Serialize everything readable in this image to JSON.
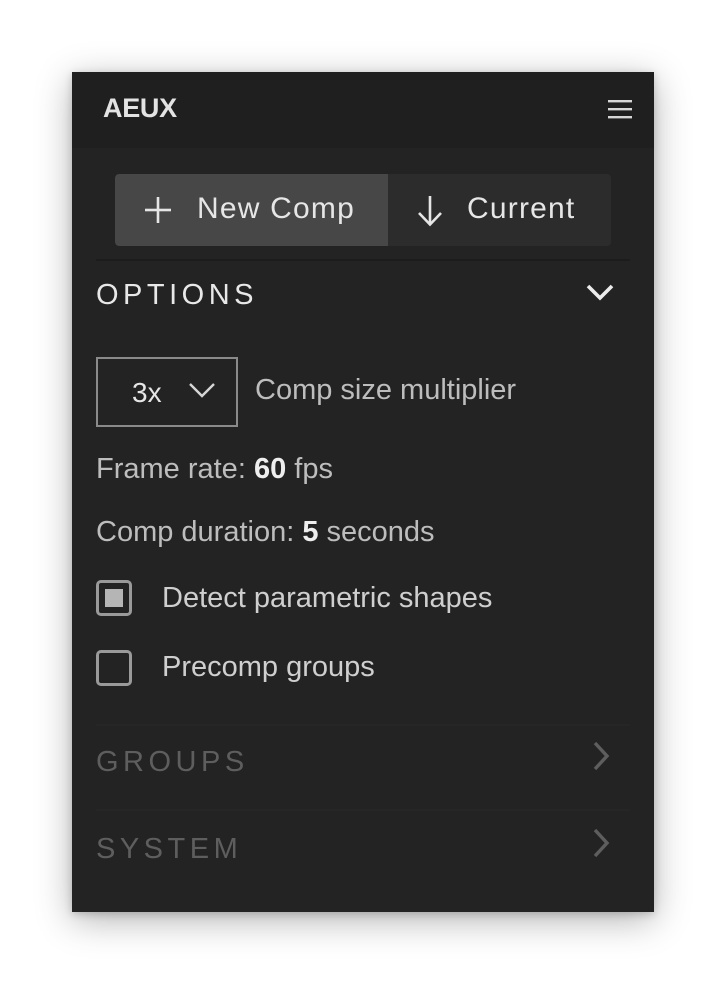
{
  "app": {
    "title": "AEUX"
  },
  "actions": {
    "new_comp_label": "New Comp",
    "current_label": "Current"
  },
  "options": {
    "title": "OPTIONS",
    "multiplier_value": "3x",
    "multiplier_label": "Comp size multiplier",
    "frame_rate_prefix": "Frame rate:",
    "frame_rate_value": "60",
    "frame_rate_unit": "fps",
    "duration_prefix": "Comp duration:",
    "duration_value": "5",
    "duration_unit": "seconds",
    "detect_parametric_label": "Detect parametric shapes",
    "detect_parametric_checked": true,
    "precomp_groups_label": "Precomp groups",
    "precomp_groups_checked": false
  },
  "sections": {
    "groups_title": "GROUPS",
    "system_title": "SYSTEM"
  },
  "icons": {
    "menu": "hamburger-menu-icon",
    "new_comp": "plus-icon",
    "current": "arrow-down-icon",
    "options_toggle": "chevron-down-icon",
    "dropdown": "chevron-down-icon",
    "groups_toggle": "chevron-right-icon",
    "system_toggle": "chevron-right-icon"
  },
  "colors": {
    "panel_bg": "#232323",
    "titlebar_bg": "#1f1f1f",
    "active_segment": "#474747",
    "text_primary": "#e6e6e6",
    "text_muted": "#5e5e5e"
  }
}
